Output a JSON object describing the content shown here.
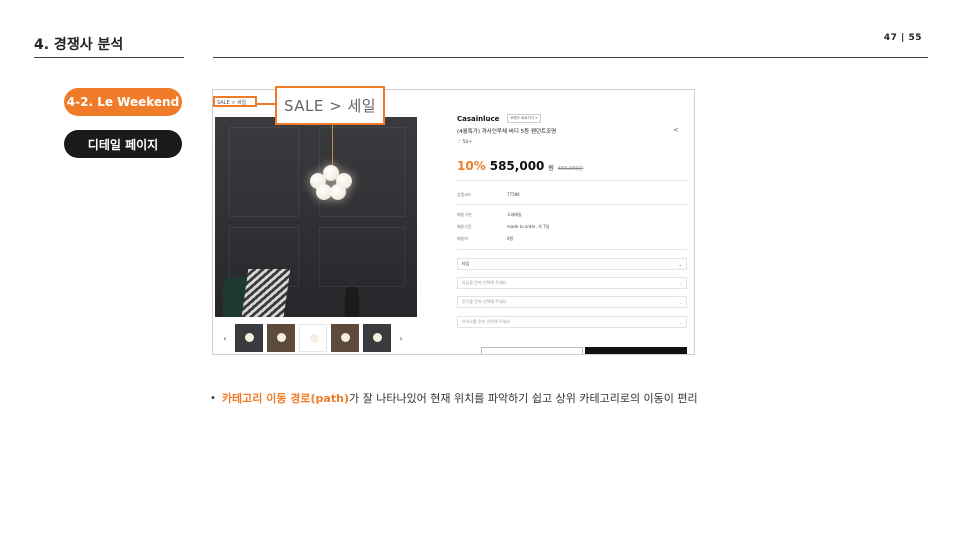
{
  "header": {
    "section_title": "4. 경쟁사 분석",
    "page_number": "47",
    "page_separator": "|",
    "page_total": "55"
  },
  "labels": {
    "sub_section": "4-2. Le Weekend",
    "page_type": "디테일 페이지"
  },
  "callout": {
    "text": "SALE  >  세일"
  },
  "screenshot": {
    "breadcrumb": "SALE > 세일",
    "brand": "Casainluce",
    "brand_tag": "브랜드 바로가기 >",
    "product_name": "(4월특가) 까사인루체 버디 5등 펜던트조명",
    "likes": "♡ 50+",
    "discount": "10%",
    "price": "585,000",
    "won": "원",
    "original_price": "650,000원",
    "specs": [
      {
        "key": "상품코드",
        "value": "77596"
      },
      {
        "key": "배송구분",
        "value": "국내배송"
      },
      {
        "key": "배송기간",
        "value": "made to order, 약 7일"
      },
      {
        "key": "배송비",
        "value": "0원"
      }
    ],
    "options": [
      "타입",
      "타입을 먼저 선택해 주세요",
      "전구를 먼저 선택해 주세요",
      "하이오를 먼저 선택해 주세요"
    ],
    "prev_arrow": "‹",
    "next_arrow": "›",
    "zoom_icon": "⌕"
  },
  "bullet": {
    "highlight": "카테고리 이동 경로(path)",
    "rest": "가 잘 나타나있어 현재 위치를 파악하기 쉽고 상위 카테고리로의 이동이 편리"
  },
  "colors": {
    "accent": "#f07c2a",
    "dark_pill": "#1a1a1a"
  }
}
